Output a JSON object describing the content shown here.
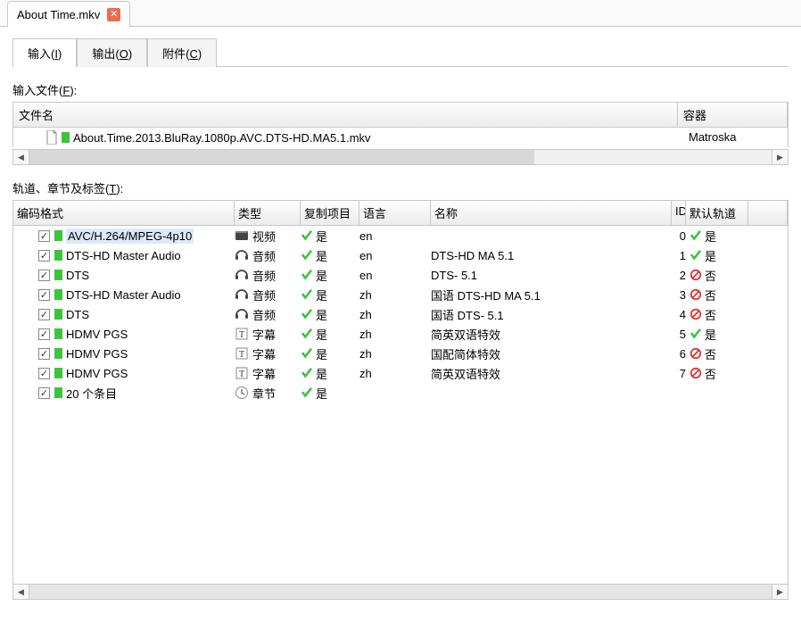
{
  "fileTab": {
    "name": "About Time.mkv"
  },
  "mainTabs": {
    "input": "输入",
    "input_key": "I",
    "output": "输出",
    "output_key": "O",
    "attach": "附件",
    "attach_key": "C"
  },
  "labels": {
    "inputFiles": "输入文件",
    "inputFiles_key": "F",
    "tracks": "轨道、章节及标签",
    "tracks_key": "T"
  },
  "fileTable": {
    "cols": {
      "name": "文件名",
      "container": "容器"
    },
    "rows": [
      {
        "name": "About.Time.2013.BluRay.1080p.AVC.DTS-HD.MA5.1.mkv",
        "container": "Matroska"
      }
    ]
  },
  "tracksTable": {
    "cols": {
      "codec": "编码格式",
      "type": "类型",
      "copy": "复制项目",
      "lang": "语言",
      "name": "名称",
      "id": "ID",
      "def": "默认轨道"
    },
    "rows": [
      {
        "checked": true,
        "codec": "AVC/H.264/MPEG-4p10",
        "typeIcon": "video",
        "type": "视频",
        "copy": "是",
        "lang": "en",
        "name": "",
        "id": "0",
        "defYes": true,
        "def": "是",
        "sel": true
      },
      {
        "checked": true,
        "codec": "DTS-HD Master Audio",
        "typeIcon": "audio",
        "type": "音频",
        "copy": "是",
        "lang": "en",
        "name": "DTS-HD MA 5.1",
        "id": "1",
        "defYes": true,
        "def": "是"
      },
      {
        "checked": true,
        "codec": "DTS",
        "typeIcon": "audio",
        "type": "音频",
        "copy": "是",
        "lang": "en",
        "name": "DTS- 5.1",
        "id": "2",
        "defYes": false,
        "def": "否"
      },
      {
        "checked": true,
        "codec": "DTS-HD Master Audio",
        "typeIcon": "audio",
        "type": "音频",
        "copy": "是",
        "lang": "zh",
        "name": "国语 DTS-HD MA 5.1",
        "id": "3",
        "defYes": false,
        "def": "否"
      },
      {
        "checked": true,
        "codec": "DTS",
        "typeIcon": "audio",
        "type": "音频",
        "copy": "是",
        "lang": "zh",
        "name": "国语 DTS- 5.1",
        "id": "4",
        "defYes": false,
        "def": "否"
      },
      {
        "checked": true,
        "codec": "HDMV PGS",
        "typeIcon": "subtitle",
        "type": "字幕",
        "copy": "是",
        "lang": "zh",
        "name": "简英双语特效",
        "id": "5",
        "defYes": true,
        "def": "是"
      },
      {
        "checked": true,
        "codec": "HDMV PGS",
        "typeIcon": "subtitle",
        "type": "字幕",
        "copy": "是",
        "lang": "zh",
        "name": "国配简体特效",
        "id": "6",
        "defYes": false,
        "def": "否"
      },
      {
        "checked": true,
        "codec": "HDMV PGS",
        "typeIcon": "subtitle",
        "type": "字幕",
        "copy": "是",
        "lang": "zh",
        "name": "简英双语特效",
        "id": "7",
        "defYes": false,
        "def": "否"
      },
      {
        "checked": true,
        "codec": "20 个条目",
        "typeIcon": "chapter",
        "type": "章节",
        "copy": "是",
        "lang": "",
        "name": "",
        "id": "",
        "defYes": null,
        "def": ""
      }
    ]
  }
}
